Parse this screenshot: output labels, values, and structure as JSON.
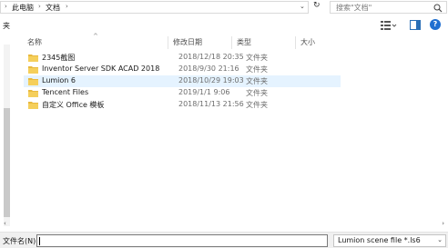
{
  "breadcrumb": {
    "items": [
      "此电脑",
      "文档"
    ],
    "separator": "›"
  },
  "search": {
    "placeholder": "搜索\"文档\""
  },
  "toolbar": {
    "left_label": "夹",
    "help_label": "?"
  },
  "columns": {
    "name": "名称",
    "date": "修改日期",
    "type": "类型",
    "size": "大小"
  },
  "files": [
    {
      "name": "2345截图",
      "date": "2018/12/18 20:35",
      "type": "文件夹",
      "selected": false
    },
    {
      "name": "Inventor Server SDK ACAD 2018",
      "date": "2018/9/30 21:16",
      "type": "文件夹",
      "selected": false
    },
    {
      "name": "Lumion 6",
      "date": "2018/10/29 19:03",
      "type": "文件夹",
      "selected": true
    },
    {
      "name": "Tencent Files",
      "date": "2019/1/1 9:06",
      "type": "文件夹",
      "selected": false
    },
    {
      "name": "自定义 Office 模板",
      "date": "2018/11/13 21:56",
      "type": "文件夹",
      "selected": false
    }
  ],
  "bottom": {
    "filename_label": "文件名(N):",
    "filename_value": "",
    "filetype_value": "Lumion scene file *.ls6"
  },
  "colors": {
    "folder": "#e8b93e",
    "selected_row": "#e5f3ff",
    "accent": "#1f6fd0"
  }
}
